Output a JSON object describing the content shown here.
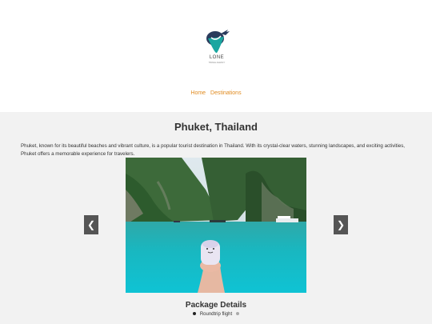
{
  "brand": {
    "name": "LONE",
    "tagline": "TRAVEL AGENCY",
    "accent": "#1aa6a0"
  },
  "nav": {
    "items": [
      {
        "label": "Home"
      },
      {
        "label": "Destinations"
      }
    ],
    "link_color": "#e08a1e"
  },
  "destination": {
    "title": "Phuket, Thailand",
    "description": "Phuket, known for its beautiful beaches and vibrant culture, is a popular tourist destination in Thailand. With its crystal-clear waters, stunning landscapes, and exciting activities, Phuket offers a memorable experience for travelers."
  },
  "carousel": {
    "prev_icon": "❮",
    "next_icon": "❯"
  },
  "package": {
    "title": "Package Details",
    "items": [
      "Roundtrip flight"
    ]
  }
}
